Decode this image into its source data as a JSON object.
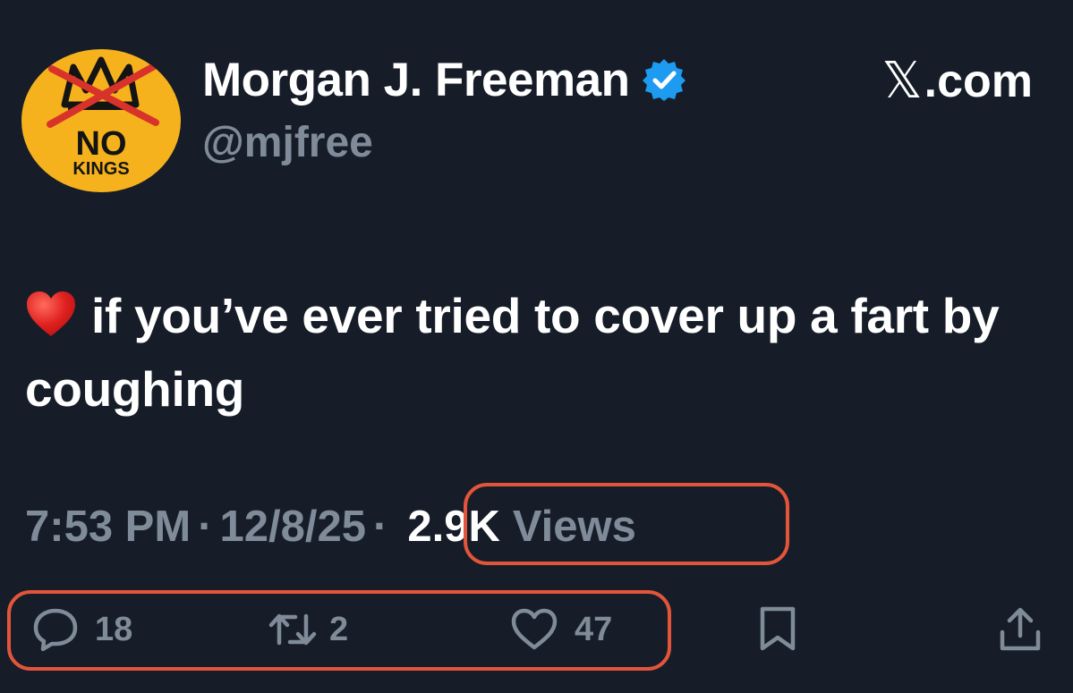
{
  "author": {
    "display_name": "Morgan J. Freeman",
    "handle": "@mjfree",
    "verified": true,
    "avatar_text_top": "NO",
    "avatar_text_bottom": "KINGS"
  },
  "brand": {
    "x_glyph": "𝕏",
    "suffix": ".com"
  },
  "tweet": {
    "emoji": "heart-emoji",
    "text": "if you’ve ever tried to cover up a fart by coughing"
  },
  "meta": {
    "time": "7:53 PM",
    "separator": "·",
    "date": "12/8/25",
    "views_count": "2.9K",
    "views_label": "Views"
  },
  "actions": {
    "replies": "18",
    "reposts": "2",
    "likes": "47"
  },
  "colors": {
    "background": "#161d28",
    "text_primary": "#ffffff",
    "text_secondary": "#7f8b98",
    "verified_blue": "#1d9bf0",
    "highlight": "#e2553a",
    "avatar_yellow": "#f6b21d"
  }
}
